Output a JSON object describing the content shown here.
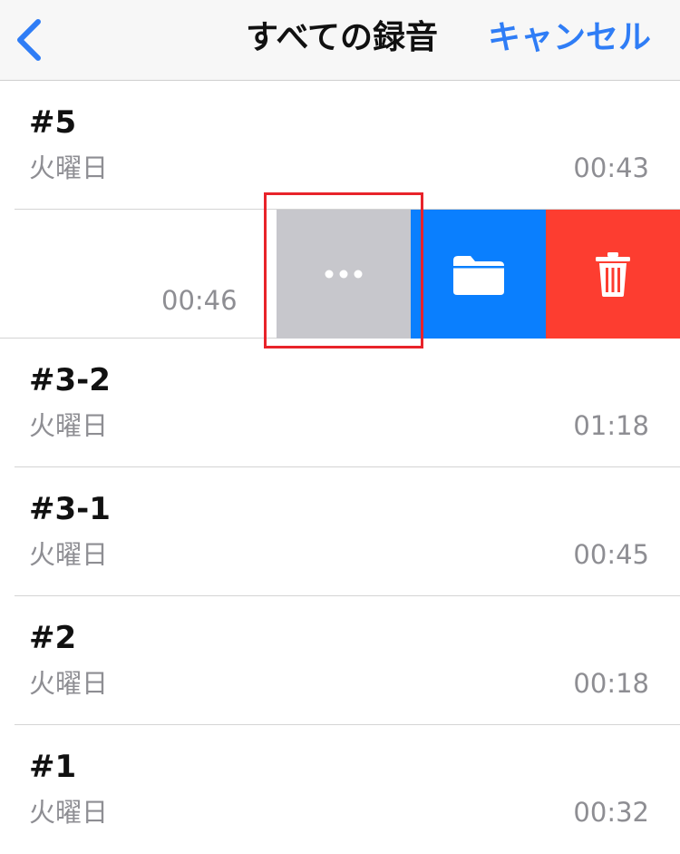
{
  "navbar": {
    "title": "すべての録音",
    "cancel_label": "キャンセル",
    "back_icon": "chevron-left-icon"
  },
  "colors": {
    "accent": "#2f7df6",
    "more_action": "#c7c7cc",
    "folder_action": "#0a7ffe",
    "delete_action": "#fd3d30",
    "highlight_border": "#e8232a"
  },
  "recordings": [
    {
      "title": "#5",
      "date": "火曜日",
      "duration": "00:43"
    },
    {
      "title": "",
      "date": "",
      "duration": "00:46",
      "swiped": true
    },
    {
      "title": "#3-2",
      "date": "火曜日",
      "duration": "01:18"
    },
    {
      "title": "#3-1",
      "date": "火曜日",
      "duration": "00:45"
    },
    {
      "title": "#2",
      "date": "火曜日",
      "duration": "00:18"
    },
    {
      "title": "#1",
      "date": "火曜日",
      "duration": "00:32"
    }
  ],
  "swipe_actions": [
    {
      "icon": "ellipsis-icon"
    },
    {
      "icon": "folder-icon"
    },
    {
      "icon": "trash-icon"
    }
  ]
}
